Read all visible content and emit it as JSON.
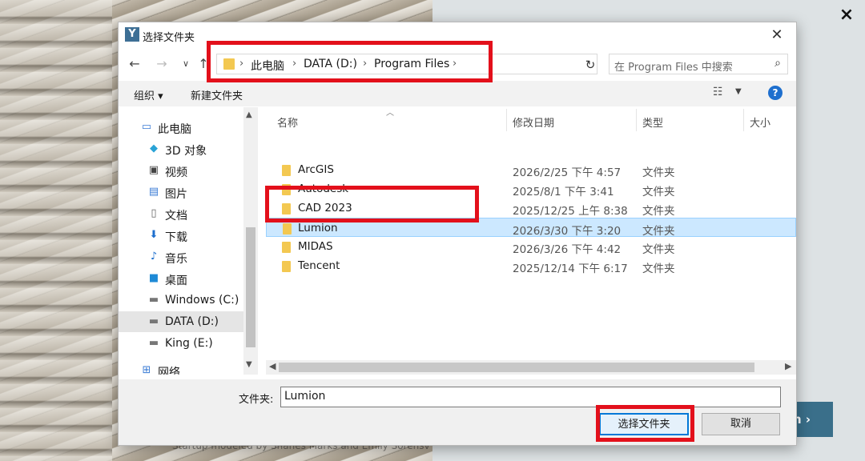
{
  "background": {
    "caption": "Startup modeled by Shanes Marks and Emily Sorensvo",
    "next_label": "n ›",
    "close_glyph": "×"
  },
  "dialog": {
    "title": "选择文件夹",
    "app_icon": "Y",
    "close_glyph": "✕"
  },
  "nav": {
    "back": "←",
    "forward": "→",
    "recent": "∨",
    "up": "↑",
    "breadcrumb": [
      "此电脑",
      "DATA (D:)",
      "Program Files"
    ],
    "refresh": "↻",
    "search_placeholder": "在 Program Files 中搜索"
  },
  "toolbar": {
    "organize": "组织 ▾",
    "new_folder": "新建文件夹",
    "help": "?"
  },
  "sidebar": {
    "items": [
      {
        "label": "此电脑",
        "icon": "computer-icon"
      },
      {
        "label": "3D 对象",
        "icon": "cube-icon"
      },
      {
        "label": "视频",
        "icon": "video-icon"
      },
      {
        "label": "图片",
        "icon": "picture-icon"
      },
      {
        "label": "文档",
        "icon": "document-icon"
      },
      {
        "label": "下载",
        "icon": "download-icon"
      },
      {
        "label": "音乐",
        "icon": "music-icon"
      },
      {
        "label": "桌面",
        "icon": "desktop-icon"
      },
      {
        "label": "Windows (C:)",
        "icon": "drive-icon"
      },
      {
        "label": "DATA (D:)",
        "icon": "drive-icon",
        "selected": true
      },
      {
        "label": "King (E:)",
        "icon": "drive-icon"
      },
      {
        "label": "网络",
        "icon": "network-icon"
      }
    ]
  },
  "columns": {
    "name": "名称",
    "modified": "修改日期",
    "type": "类型",
    "size": "大小"
  },
  "files": [
    {
      "name": "ArcGIS",
      "modified": "2026/2/25 下午 4:57",
      "type": "文件夹"
    },
    {
      "name": "Autodesk",
      "modified": "2025/8/1 下午 3:41",
      "type": "文件夹"
    },
    {
      "name": "CAD 2023",
      "modified": "2025/12/25 上午 8:38",
      "type": "文件夹"
    },
    {
      "name": "Lumion",
      "modified": "2026/3/30 下午 3:20",
      "type": "文件夹",
      "selected": true
    },
    {
      "name": "MIDAS",
      "modified": "2026/3/26 下午 4:42",
      "type": "文件夹"
    },
    {
      "name": "Tencent",
      "modified": "2025/12/14 下午 6:17",
      "type": "文件夹"
    }
  ],
  "footer": {
    "folder_label": "文件夹:",
    "folder_value": "Lumion",
    "select_button": "选择文件夹",
    "cancel_button": "取消"
  },
  "colors": {
    "highlight": "#e3101b",
    "selection": "#cce8ff",
    "accent": "#0078d7"
  }
}
